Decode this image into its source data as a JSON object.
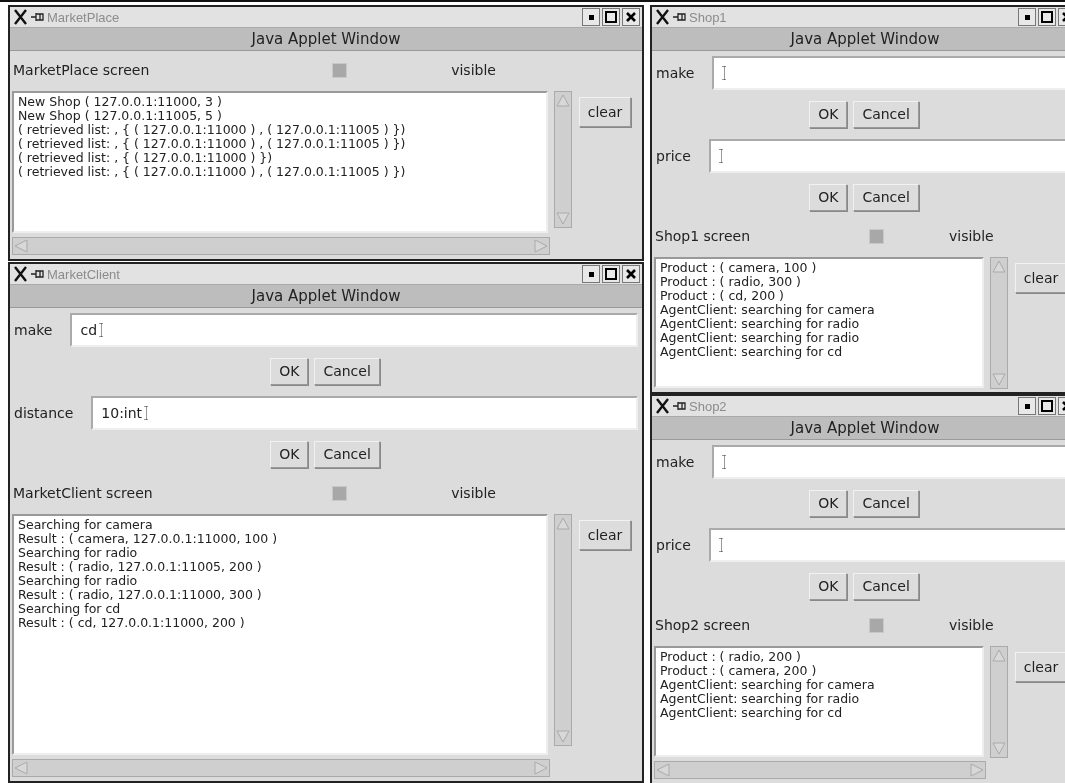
{
  "windows": [
    {
      "title": "MarketPlace",
      "banner": "Java Applet Window",
      "screen": {
        "label": "MarketPlace screen",
        "checkbox_label": "visible",
        "checked": false
      },
      "log": [
        "New Shop ( 127.0.0.1:11000, 3 )",
        "New Shop ( 127.0.0.1:11005, 5 )",
        "( retrieved list: , { ( 127.0.0.1:11000 ) , ( 127.0.0.1:11005 ) })",
        "( retrieved list: , { ( 127.0.0.1:11000 ) , ( 127.0.0.1:11005 ) })",
        "( retrieved list: , { ( 127.0.0.1:11000 ) })",
        "( retrieved list: , { ( 127.0.0.1:11000 ) , ( 127.0.0.1:11005 ) })"
      ],
      "clear_button": "clear"
    },
    {
      "title": "MarketClient",
      "banner": "Java Applet Window",
      "fields": [
        {
          "label": "make",
          "value": "cd",
          "buttons": [
            "OK",
            "Cancel"
          ]
        },
        {
          "label": "distance",
          "value": "10:int",
          "buttons": [
            "OK",
            "Cancel"
          ]
        }
      ],
      "screen": {
        "label": "MarketClient screen",
        "checkbox_label": "visible",
        "checked": false
      },
      "log": [
        "Searching for camera",
        "Result : ( camera, 127.0.0.1:11000, 100 )",
        "Searching for radio",
        "Result : ( radio, 127.0.0.1:11005, 200 )",
        "Searching for radio",
        "Result : ( radio, 127.0.0.1:11000, 300 )",
        "Searching for cd",
        "Result : ( cd, 127.0.0.1:11000, 200 )"
      ],
      "clear_button": "clear"
    },
    {
      "title": "Shop1",
      "banner": "Java Applet Window",
      "fields": [
        {
          "label": "make",
          "buttons": [
            "OK",
            "Cancel"
          ]
        },
        {
          "label": "price",
          "buttons": [
            "OK",
            "Cancel"
          ]
        }
      ],
      "screen": {
        "label": "Shop1 screen",
        "checkbox_label": "visible",
        "checked": false
      },
      "log": [
        "Product : ( camera, 100 )",
        "Product : ( radio, 300 )",
        "Product : ( cd, 200 )",
        "AgentClient: searching for camera",
        "AgentClient: searching for radio",
        "AgentClient: searching for radio",
        "AgentClient: searching for cd"
      ],
      "clear_button": "clear"
    },
    {
      "title": "Shop2",
      "banner": "Java Applet Window",
      "fields": [
        {
          "label": "make",
          "buttons": [
            "OK",
            "Cancel"
          ]
        },
        {
          "label": "price",
          "buttons": [
            "OK",
            "Cancel"
          ]
        }
      ],
      "screen": {
        "label": "Shop2 screen",
        "checkbox_label": "visible",
        "checked": false
      },
      "log": [
        "Product : ( radio, 200 )",
        "Product : ( camera, 200 )",
        "AgentClient: searching for camera",
        "AgentClient: searching for radio",
        "AgentClient: searching for cd"
      ],
      "clear_button": "clear"
    }
  ]
}
